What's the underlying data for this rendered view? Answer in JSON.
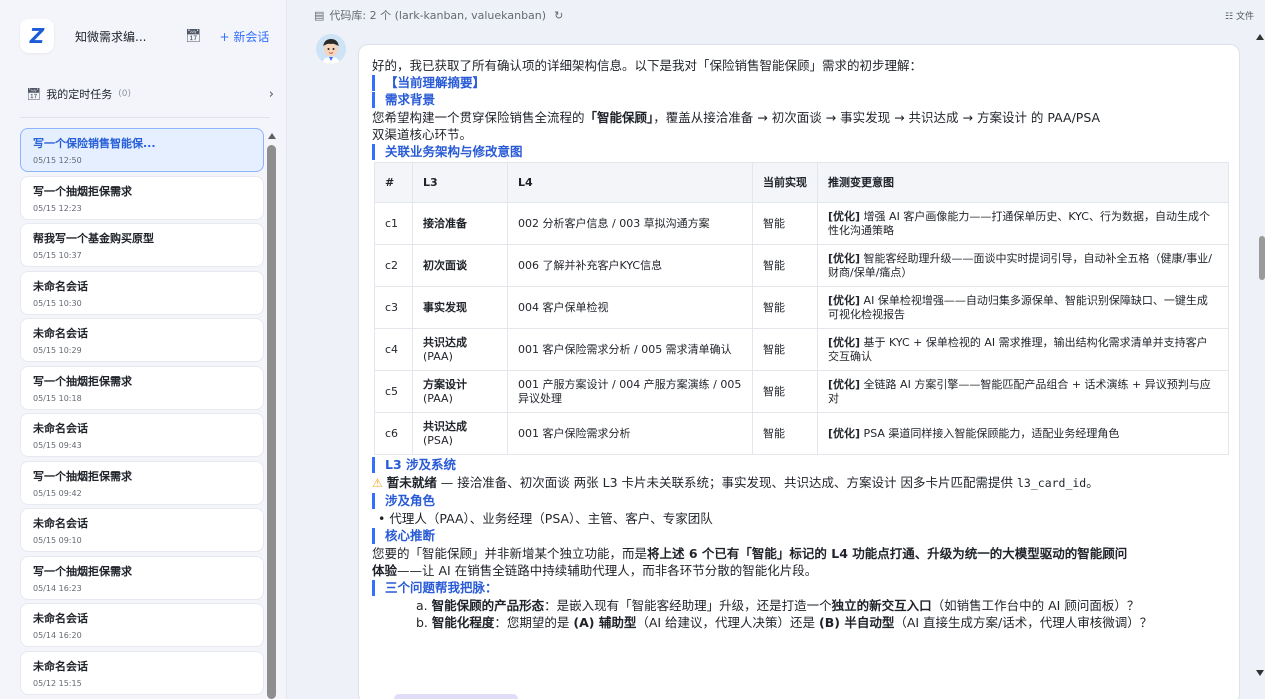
{
  "sidebar": {
    "logo_letter": "Z",
    "app_title": "知微需求编...",
    "calendar_icon": "calendar-clock-icon",
    "new_chat": "+ 新会话",
    "tasks_label": "我的定时任务",
    "tasks_count": "(0)",
    "conversations": [
      {
        "title": "写一个保险销售智能保...",
        "date": "05/15 12:50",
        "active": true
      },
      {
        "title": "写一个抽烟拒保需求",
        "date": "05/15 12:23"
      },
      {
        "title": "帮我写一个基金购买原型",
        "date": "05/15 10:37"
      },
      {
        "title": "未命名会话",
        "date": "05/15 10:30"
      },
      {
        "title": "未命名会话",
        "date": "05/15 10:29"
      },
      {
        "title": "写一个抽烟拒保需求",
        "date": "05/15 10:18"
      },
      {
        "title": "未命名会话",
        "date": "05/15 09:43"
      },
      {
        "title": "写一个抽烟拒保需求",
        "date": "05/15 09:42"
      },
      {
        "title": "未命名会话",
        "date": "05/15 09:10"
      },
      {
        "title": "写一个抽烟拒保需求",
        "date": "05/14 16:23"
      },
      {
        "title": "未命名会话",
        "date": "05/14 16:20"
      },
      {
        "title": "未命名会话",
        "date": "05/12 15:15"
      }
    ]
  },
  "topbar": {
    "repo_text": "代码库: 2 个 (lark-kanban, valuekanban)",
    "files": "文件"
  },
  "message": {
    "intro": "好的，我已获取了所有确认项的详细架构信息。以下是我对「保险销售智能保顾」需求的初步理解：",
    "h_summary": "【当前理解摘要】",
    "h_background": "需求背景",
    "bg_1": "您希望构建一个贯穿保险销售全流程的",
    "bg_bold": "「智能保顾」",
    "bg_2": "，覆盖从接洽准备 → 初次面谈 → 事实发现 → 共识达成 → 方案设计 的 PAA/PSA",
    "bg_3": "双渠道核心环节。",
    "h_arch": "关联业务架构与修改意图",
    "table_headers": [
      "#",
      "L3",
      "L4",
      "当前实现",
      "推测变更意图"
    ],
    "rows": [
      {
        "id": "c1",
        "l3": "接洽准备",
        "l3sub": "",
        "l4": "002 分析客户信息 / 003 草拟沟通方案",
        "impl": "智能",
        "tag": "[优化]",
        "intent": " 增强 AI 客户画像能力——打通保单历史、KYC、行为数据，自动生成个性化沟通策略"
      },
      {
        "id": "c2",
        "l3": "初次面谈",
        "l3sub": "",
        "l4": "006 了解并补充客户KYC信息",
        "impl": "智能",
        "tag": "[优化]",
        "intent": " 智能客经助理升级——面谈中实时提词引导，自动补全五格（健康/事业/财商/保单/痛点）"
      },
      {
        "id": "c3",
        "l3": "事实发现",
        "l3sub": "",
        "l4": "004 客户保单检视",
        "impl": "智能",
        "tag": "[优化]",
        "intent": " AI 保单检视增强——自动归集多源保单、智能识别保障缺口、一键生成可视化检视报告"
      },
      {
        "id": "c4",
        "l3": "共识达成",
        "l3sub": "(PAA)",
        "l4": "001 客户保险需求分析 / 005 需求清单确认",
        "impl": "智能",
        "tag": "[优化]",
        "intent": " 基于 KYC + 保单检视的 AI 需求推理，输出结构化需求清单并支持客户交互确认"
      },
      {
        "id": "c5",
        "l3": "方案设计",
        "l3sub": "(PAA)",
        "l4": "001 产服方案设计 / 004 产服方案演练 / 005 异议处理",
        "impl": "智能",
        "tag": "[优化]",
        "intent": " 全链路 AI 方案引擎——智能匹配产品组合 + 话术演练 + 异议预判与应对"
      },
      {
        "id": "c6",
        "l3": "共识达成",
        "l3sub": "(PSA)",
        "l4": "001 客户保险需求分析",
        "impl": "智能",
        "tag": "[优化]",
        "intent": " PSA 渠道同样接入智能保顾能力，适配业务经理角色"
      }
    ],
    "h_systems": "L3 涉及系统",
    "warn_bold": "暂未就绪",
    "warn_text": " — 接洽准备、初次面谈 两张 L3 卡片未关联系统；事实发现、共识达成、方案设计 因多卡片匹配需提供 ",
    "warn_code": "l3_card_id",
    "warn_end": "。",
    "h_roles": "涉及角色",
    "roles": "• 代理人（PAA）、业务经理（PSA）、主管、客户、专家团队",
    "h_core": "核心推断",
    "core_1": "您要的「智能保顾」并非新增某个独立功能，而是",
    "core_bold": "将上述 6 个已有「智能」标记的 L4 功能点打通、升级为统一的大模型驱动的智能顾问",
    "core_bold2": "体验",
    "core_2": "——让 AI 在销售全链路中持续辅助代理人，而非各环节分散的智能化片段。",
    "h_questions": "三个问题帮我把脉：",
    "qa_pre": "a. ",
    "qa_bold": "智能保顾的产品形态",
    "qa_1": "：是嵌入现有「智能客经助理」升级，还是打造一个",
    "qa_bold2": "独立的新交互入口",
    "qa_2": "（如销售工作台中的 AI 顾问面板）？",
    "qb_pre": "b. ",
    "qb_bold": "智能化程度",
    "qb_1": "：您期望的是 ",
    "qb_bold2": "(A) 辅助型",
    "qb_2": "（AI 给建议，代理人决策）还是 ",
    "qb_bold3": "(B) 半自动型",
    "qb_3": "（AI 直接生成方案/话术，代理人审核微调）？"
  }
}
